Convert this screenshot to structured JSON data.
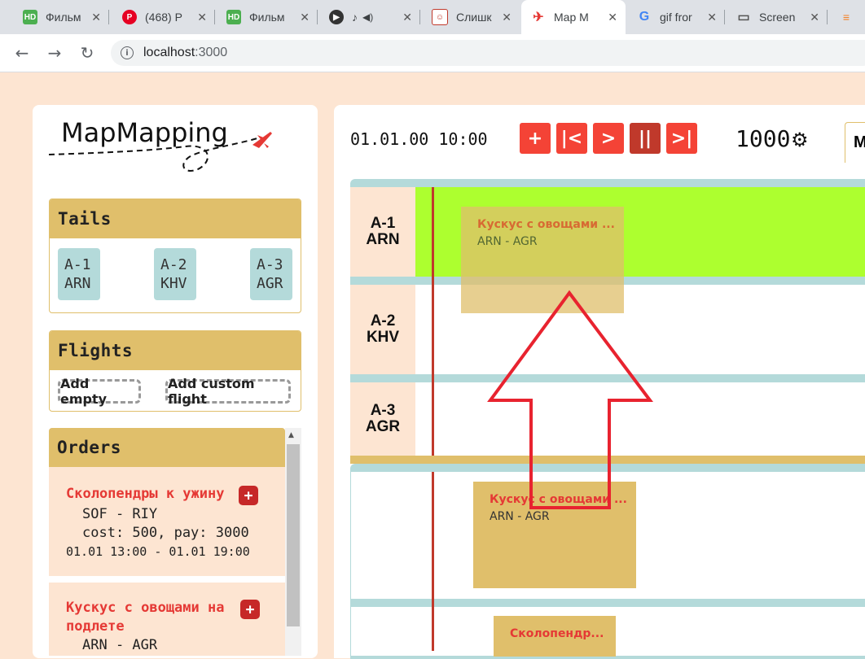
{
  "browser": {
    "tabs": [
      {
        "icon": "hd-icon",
        "icon_text": "HD",
        "title": "Фильм"
      },
      {
        "icon": "pinterest-icon",
        "icon_text": "P",
        "title": "(468) P"
      },
      {
        "icon": "hd-icon",
        "icon_text": "HD",
        "title": "Фильм"
      },
      {
        "icon": "play-icon",
        "icon_text": "▶",
        "title": ""
      },
      {
        "icon": "app-icon",
        "icon_text": "☺",
        "title": "Слишк"
      },
      {
        "icon": "plane-icon",
        "icon_text": "✈",
        "title": "Map M"
      },
      {
        "icon": "google-icon",
        "icon_text": "G",
        "title": "gif fror"
      },
      {
        "icon": "monitor-icon",
        "icon_text": "▭",
        "title": "Screen"
      }
    ],
    "url_host": "localhost",
    "url_port": ":3000"
  },
  "sidebar": {
    "logo": "MapMapping",
    "tails_title": "Tails",
    "tails": [
      {
        "code": "A-1",
        "airport": "ARN"
      },
      {
        "code": "A-2",
        "airport": "KHV"
      },
      {
        "code": "A-3",
        "airport": "AGR"
      }
    ],
    "flights_title": "Flights",
    "add_empty": "Add empty",
    "add_custom": "Add custom flight",
    "orders_title": "Orders",
    "orders": [
      {
        "title": "Сколопендры к ужину",
        "route": "SOF - RIY",
        "cost": "cost: 500, pay: 3000",
        "time": "01.01 13:00 - 01.01 19:00"
      },
      {
        "title_line1": "Кускус с овощами на",
        "title_line2": "подлете",
        "route": "ARN - AGR"
      }
    ]
  },
  "main": {
    "clock": "01.01.00 10:00",
    "controls": {
      "add": "+",
      "start": "|<",
      "play": ">",
      "pause": "||",
      "end": ">|"
    },
    "speed": "1000",
    "mode_tab": "M",
    "rows": [
      {
        "code": "A-1",
        "airport": "ARN"
      },
      {
        "code": "A-2",
        "airport": "KHV"
      },
      {
        "code": "A-3",
        "airport": "AGR"
      }
    ],
    "flights": [
      {
        "title": "Кускус с овощами ...",
        "route": "ARN - AGR"
      },
      {
        "title": "Кускус с овощами ...",
        "route": "ARN - AGR"
      },
      {
        "title": "Сколопендр..."
      }
    ]
  },
  "colors": {
    "page_bg": "#fde5d2",
    "accent_gold": "#e0bf6b",
    "control_red": "#f44336",
    "tail_chip": "#b4dada",
    "active_row": "#adff2f",
    "arrow": "#e8232f"
  }
}
